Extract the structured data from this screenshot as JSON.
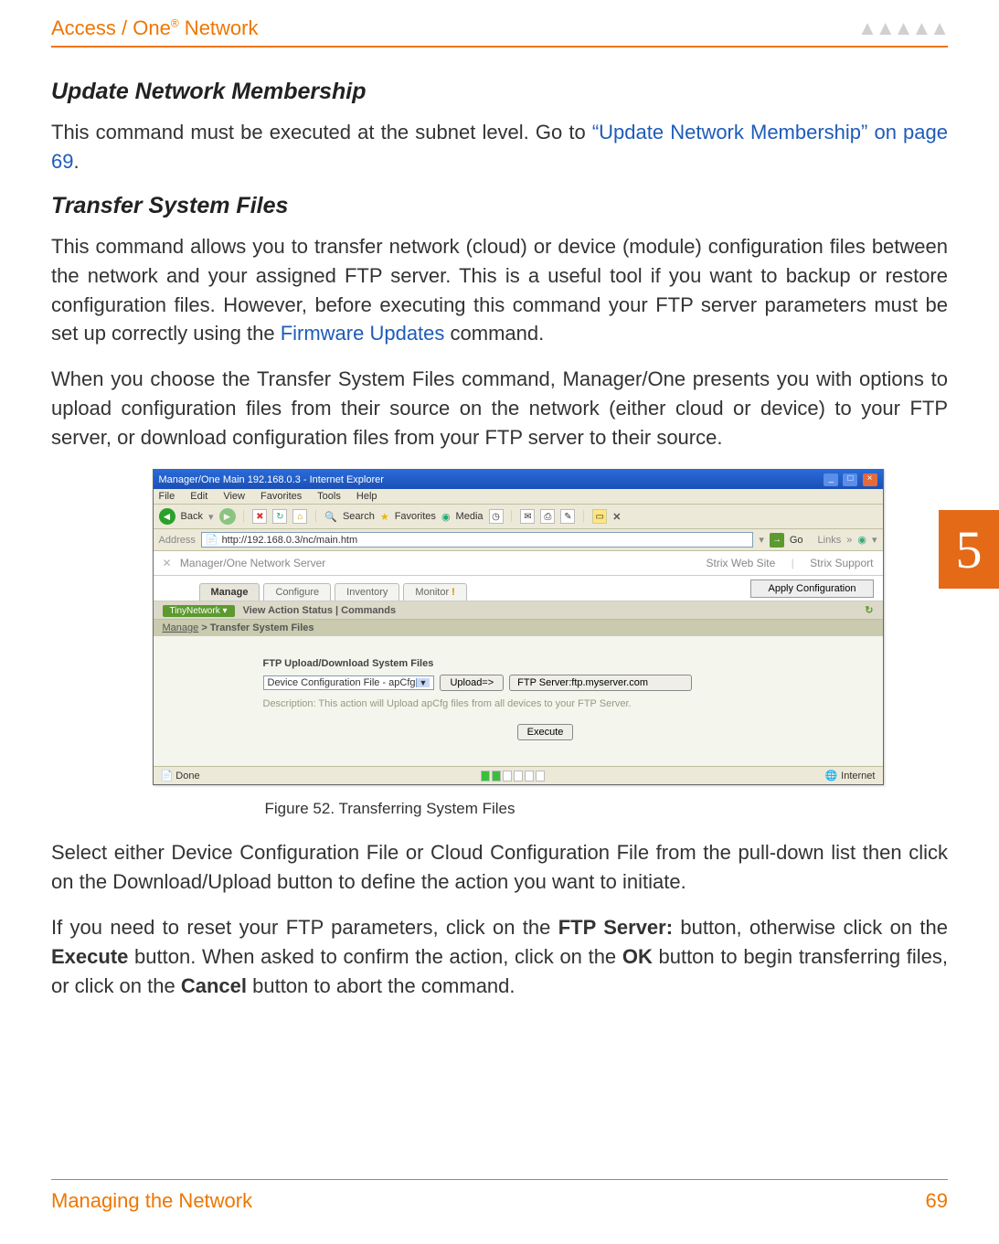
{
  "header": {
    "brand_prefix": "Access / One",
    "brand_reg": "®",
    "brand_suffix": " Network"
  },
  "sections": {
    "s1_title": "Update Network Membership",
    "s1_p1_a": "This command must be executed at the subnet level. Go to ",
    "s1_p1_link": "“Update Network Membership” on page 69",
    "s1_p1_b": ".",
    "s2_title": "Transfer System Files",
    "s2_p1_a": "This command allows you to transfer network (cloud) or device (module) configuration files between the network and your assigned FTP server. This is a useful tool if you want to backup or restore configuration files. However, before executing this command your FTP server parameters must be set up correctly using the ",
    "s2_p1_link": "Firmware Updates",
    "s2_p1_b": " command.",
    "s2_p2": "When you choose the Transfer System Files command, Manager/One presents you with options to upload configuration files from their source on the network (either cloud or device) to your FTP server, or download configuration files from your FTP server to their source.",
    "caption": "Figure 52. Transferring System Files",
    "s2_p3": "Select either Device Configuration File or Cloud Configuration File from the pull-down list then click on the Download/Upload button to define the action you want to initiate.",
    "s2_p4_a": "If you need to reset your FTP parameters, click on the ",
    "s2_p4_b1": "FTP Server:",
    "s2_p4_c": " button, otherwise click on the ",
    "s2_p4_b2": "Execute",
    "s2_p4_d": " button. When asked to confirm the action, click on the ",
    "s2_p4_b3": "OK",
    "s2_p4_e": " button to begin transferring files, or click on the ",
    "s2_p4_b4": "Cancel",
    "s2_p4_f": " button to abort the command."
  },
  "screenshot": {
    "title": "Manager/One Main 192.168.0.3 - Internet Explorer",
    "menu": {
      "file": "File",
      "edit": "Edit",
      "view": "View",
      "fav": "Favorites",
      "tools": "Tools",
      "help": "Help"
    },
    "toolbar": {
      "back": "Back",
      "search": "Search",
      "favorites": "Favorites",
      "media": "Media"
    },
    "address_label": "Address",
    "address_value": "http://192.168.0.3/nc/main.htm",
    "go": "Go",
    "links": "Links",
    "app_title": "Manager/One Network Server",
    "hl1": "Strix Web Site",
    "hl2": "Strix Support",
    "tabs": {
      "manage": "Manage",
      "configure": "Configure",
      "inventory": "Inventory",
      "monitor": "Monitor"
    },
    "apply": "Apply Configuration",
    "subbar_pill": "TinyNetwork",
    "subbar_text": "View Action Status  |  Commands",
    "crumb_a": "Manage",
    "crumb_b": " > Transfer System Files",
    "panel_title": "FTP Upload/Download System Files",
    "select_value": "Device Configuration File - apCfg",
    "upload_btn": "Upload=>",
    "ftp_btn": "FTP Server:ftp.myserver.com",
    "desc": "Description: This action will Upload apCfg files from all devices to your FTP Server.",
    "execute": "Execute",
    "status_done": "Done",
    "status_zone": "Internet"
  },
  "side_tab": "5",
  "footer": {
    "left": "Managing the Network",
    "right": "69"
  }
}
